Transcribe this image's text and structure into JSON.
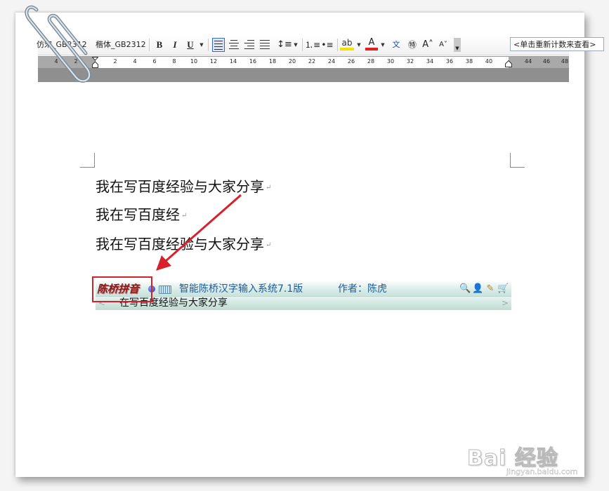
{
  "toolbar": {
    "font_name": "仿宋_GB2312",
    "font_name_alt": "楷体_GB2312",
    "bold_label": "B",
    "italic_label": "I",
    "underline_label": "U",
    "increase_font_label": "A",
    "decrease_font_label": "A",
    "wordcount_placeholder": "<单击重新计数来查看>"
  },
  "ruler": {
    "left_numbers": [
      "4",
      "2"
    ],
    "numbers": [
      "2",
      "4",
      "6",
      "8",
      "10",
      "12",
      "14",
      "16",
      "18",
      "20",
      "22",
      "24",
      "26",
      "28",
      "30",
      "32",
      "34",
      "36",
      "38",
      "40"
    ],
    "right_numbers": [
      "44",
      "46",
      "48"
    ]
  },
  "document": {
    "lines": [
      "我在写百度经验与大家分享",
      "我在写百度经",
      "我在写百度经验与大家分享"
    ],
    "paragraph_mark": "↵"
  },
  "ime": {
    "logo_text": "陈桥拼音",
    "title": "智能陈桥汉字输入系统7.1版",
    "author": "作者：陈虎",
    "composition": "在写百度经验与大家分享",
    "left_arrow": "<",
    "right_arrow": ">"
  },
  "watermark": {
    "brand": "Bai  经验",
    "url": "jingyan.baidu.com"
  },
  "colors": {
    "annotation": "#d8202a",
    "ime_title": "#1d5a9a",
    "ime_logo": "#8b1a1a"
  }
}
